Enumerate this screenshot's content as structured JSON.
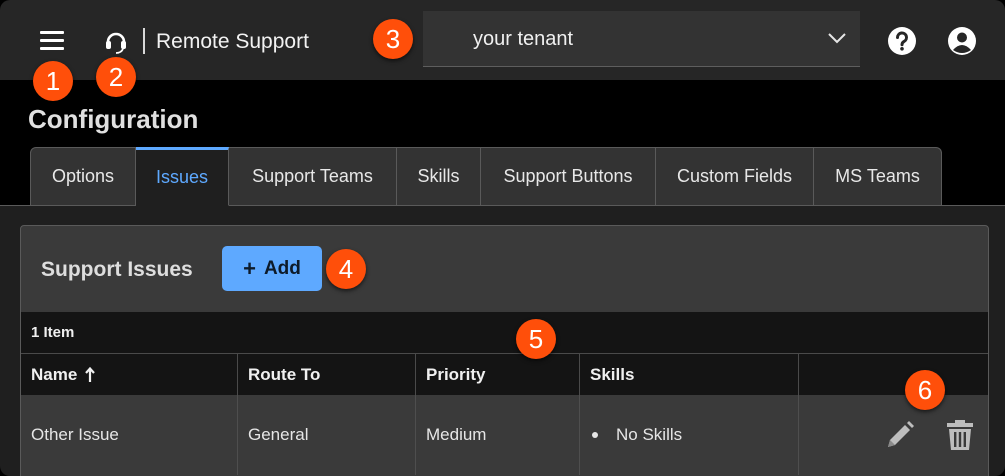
{
  "app": {
    "title": "Remote Support",
    "menu_icon": "hamburger-menu-icon",
    "logo_icon": "headset-icon"
  },
  "tenant_select": {
    "value": "your tenant",
    "icon": "chevron-down-icon"
  },
  "header_actions": {
    "help_icon": "help-circle-icon",
    "user_icon": "account-circle-icon"
  },
  "markers": [
    "1",
    "2",
    "3",
    "4",
    "5",
    "6"
  ],
  "page": {
    "title": "Configuration"
  },
  "tabs": [
    {
      "label": "Options",
      "active": false
    },
    {
      "label": "Issues",
      "active": true
    },
    {
      "label": "Support Teams",
      "active": false
    },
    {
      "label": "Skills",
      "active": false
    },
    {
      "label": "Support Buttons",
      "active": false
    },
    {
      "label": "Custom Fields",
      "active": false
    },
    {
      "label": "MS Teams",
      "active": false
    }
  ],
  "panel": {
    "title": "Support Issues",
    "add_button": {
      "plus": "+",
      "label": "Add"
    },
    "item_count": "1 Item",
    "columns": [
      "Name",
      "Route To",
      "Priority",
      "Skills",
      ""
    ],
    "sort_icon": "arrow-up-icon",
    "rows": [
      {
        "name": "Other Issue",
        "route_to": "General",
        "priority": "Medium",
        "skills": [
          "No Skills"
        ],
        "actions": {
          "edit_icon": "pencil-icon",
          "delete_icon": "trash-icon"
        }
      }
    ]
  },
  "colors": {
    "accent": "#5ea9ff",
    "marker": "#ff4f0a",
    "appbar": "#262626",
    "panel": "#3a3a3a",
    "header_row": "#141414"
  }
}
